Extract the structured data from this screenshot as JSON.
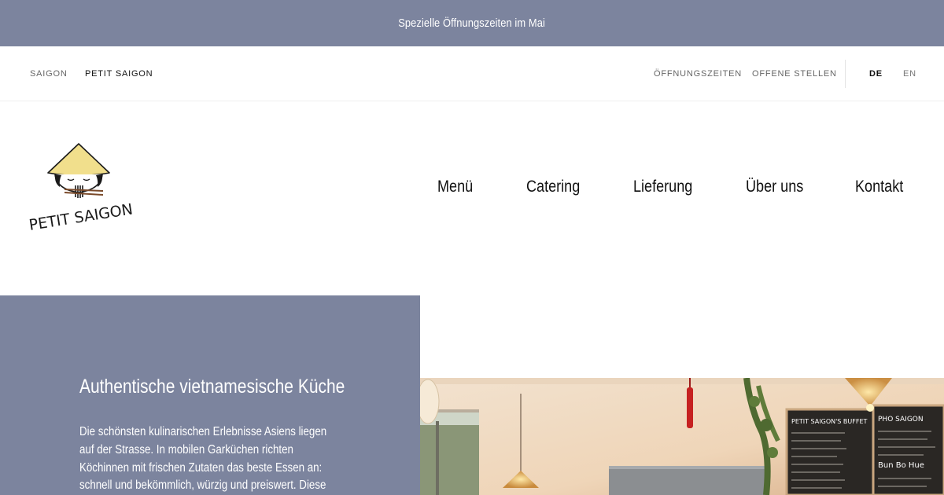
{
  "announcement": {
    "text": "Spezielle Öffnungszeiten im Mai"
  },
  "utility_nav": {
    "left": [
      {
        "label": "SAIGON",
        "active": false
      },
      {
        "label": "PETIT SAIGON",
        "active": true
      }
    ],
    "right": [
      {
        "label": "ÖFFNUNGSZEITEN"
      },
      {
        "label": "OFFENE STELLEN"
      }
    ],
    "languages": [
      {
        "label": "DE",
        "active": true
      },
      {
        "label": "EN",
        "active": false
      }
    ]
  },
  "logo": {
    "text": "PETIT SAIGON"
  },
  "main_nav": [
    {
      "label": "Menü"
    },
    {
      "label": "Catering"
    },
    {
      "label": "Lieferung"
    },
    {
      "label": "Über uns"
    },
    {
      "label": "Kontakt"
    }
  ],
  "intro": {
    "title": "Authentische vietnamesische Küche",
    "body": "Die schönsten kulinarischen Erlebnisse Asiens liegen auf der Strasse. In mobilen Garküchen richten Köchinnen mit frischen Zutaten das beste Essen an: schnell und bekömmlich, würzig und preiswert. Diese"
  },
  "photo": {
    "board_left_title": "PETIT SAIGON'S BUFFET",
    "board_right_title": "PHO SAIGON",
    "board_right_item": "Bun Bo Hue"
  },
  "colors": {
    "accent": "#7c849e",
    "text": "#1c1c1c",
    "white": "#ffffff"
  }
}
